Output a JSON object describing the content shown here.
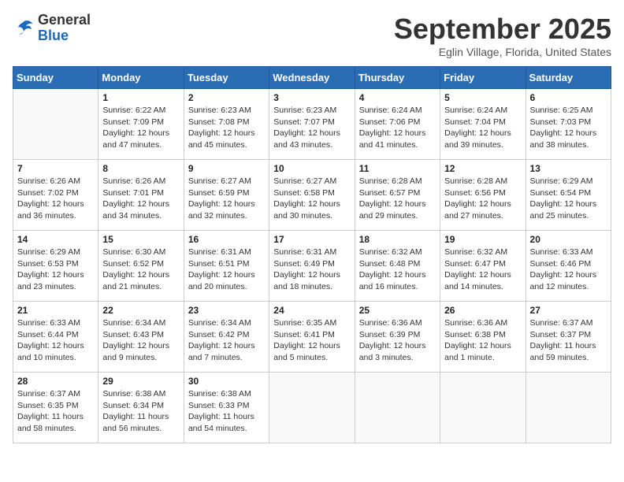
{
  "header": {
    "logo_general": "General",
    "logo_blue": "Blue",
    "month_title": "September 2025",
    "location": "Eglin Village, Florida, United States"
  },
  "weekdays": [
    "Sunday",
    "Monday",
    "Tuesday",
    "Wednesday",
    "Thursday",
    "Friday",
    "Saturday"
  ],
  "weeks": [
    [
      {
        "day": "",
        "info": ""
      },
      {
        "day": "1",
        "info": "Sunrise: 6:22 AM\nSunset: 7:09 PM\nDaylight: 12 hours\nand 47 minutes."
      },
      {
        "day": "2",
        "info": "Sunrise: 6:23 AM\nSunset: 7:08 PM\nDaylight: 12 hours\nand 45 minutes."
      },
      {
        "day": "3",
        "info": "Sunrise: 6:23 AM\nSunset: 7:07 PM\nDaylight: 12 hours\nand 43 minutes."
      },
      {
        "day": "4",
        "info": "Sunrise: 6:24 AM\nSunset: 7:06 PM\nDaylight: 12 hours\nand 41 minutes."
      },
      {
        "day": "5",
        "info": "Sunrise: 6:24 AM\nSunset: 7:04 PM\nDaylight: 12 hours\nand 39 minutes."
      },
      {
        "day": "6",
        "info": "Sunrise: 6:25 AM\nSunset: 7:03 PM\nDaylight: 12 hours\nand 38 minutes."
      }
    ],
    [
      {
        "day": "7",
        "info": "Sunrise: 6:26 AM\nSunset: 7:02 PM\nDaylight: 12 hours\nand 36 minutes."
      },
      {
        "day": "8",
        "info": "Sunrise: 6:26 AM\nSunset: 7:01 PM\nDaylight: 12 hours\nand 34 minutes."
      },
      {
        "day": "9",
        "info": "Sunrise: 6:27 AM\nSunset: 6:59 PM\nDaylight: 12 hours\nand 32 minutes."
      },
      {
        "day": "10",
        "info": "Sunrise: 6:27 AM\nSunset: 6:58 PM\nDaylight: 12 hours\nand 30 minutes."
      },
      {
        "day": "11",
        "info": "Sunrise: 6:28 AM\nSunset: 6:57 PM\nDaylight: 12 hours\nand 29 minutes."
      },
      {
        "day": "12",
        "info": "Sunrise: 6:28 AM\nSunset: 6:56 PM\nDaylight: 12 hours\nand 27 minutes."
      },
      {
        "day": "13",
        "info": "Sunrise: 6:29 AM\nSunset: 6:54 PM\nDaylight: 12 hours\nand 25 minutes."
      }
    ],
    [
      {
        "day": "14",
        "info": "Sunrise: 6:29 AM\nSunset: 6:53 PM\nDaylight: 12 hours\nand 23 minutes."
      },
      {
        "day": "15",
        "info": "Sunrise: 6:30 AM\nSunset: 6:52 PM\nDaylight: 12 hours\nand 21 minutes."
      },
      {
        "day": "16",
        "info": "Sunrise: 6:31 AM\nSunset: 6:51 PM\nDaylight: 12 hours\nand 20 minutes."
      },
      {
        "day": "17",
        "info": "Sunrise: 6:31 AM\nSunset: 6:49 PM\nDaylight: 12 hours\nand 18 minutes."
      },
      {
        "day": "18",
        "info": "Sunrise: 6:32 AM\nSunset: 6:48 PM\nDaylight: 12 hours\nand 16 minutes."
      },
      {
        "day": "19",
        "info": "Sunrise: 6:32 AM\nSunset: 6:47 PM\nDaylight: 12 hours\nand 14 minutes."
      },
      {
        "day": "20",
        "info": "Sunrise: 6:33 AM\nSunset: 6:46 PM\nDaylight: 12 hours\nand 12 minutes."
      }
    ],
    [
      {
        "day": "21",
        "info": "Sunrise: 6:33 AM\nSunset: 6:44 PM\nDaylight: 12 hours\nand 10 minutes."
      },
      {
        "day": "22",
        "info": "Sunrise: 6:34 AM\nSunset: 6:43 PM\nDaylight: 12 hours\nand 9 minutes."
      },
      {
        "day": "23",
        "info": "Sunrise: 6:34 AM\nSunset: 6:42 PM\nDaylight: 12 hours\nand 7 minutes."
      },
      {
        "day": "24",
        "info": "Sunrise: 6:35 AM\nSunset: 6:41 PM\nDaylight: 12 hours\nand 5 minutes."
      },
      {
        "day": "25",
        "info": "Sunrise: 6:36 AM\nSunset: 6:39 PM\nDaylight: 12 hours\nand 3 minutes."
      },
      {
        "day": "26",
        "info": "Sunrise: 6:36 AM\nSunset: 6:38 PM\nDaylight: 12 hours\nand 1 minute."
      },
      {
        "day": "27",
        "info": "Sunrise: 6:37 AM\nSunset: 6:37 PM\nDaylight: 11 hours\nand 59 minutes."
      }
    ],
    [
      {
        "day": "28",
        "info": "Sunrise: 6:37 AM\nSunset: 6:35 PM\nDaylight: 11 hours\nand 58 minutes."
      },
      {
        "day": "29",
        "info": "Sunrise: 6:38 AM\nSunset: 6:34 PM\nDaylight: 11 hours\nand 56 minutes."
      },
      {
        "day": "30",
        "info": "Sunrise: 6:38 AM\nSunset: 6:33 PM\nDaylight: 11 hours\nand 54 minutes."
      },
      {
        "day": "",
        "info": ""
      },
      {
        "day": "",
        "info": ""
      },
      {
        "day": "",
        "info": ""
      },
      {
        "day": "",
        "info": ""
      }
    ]
  ]
}
